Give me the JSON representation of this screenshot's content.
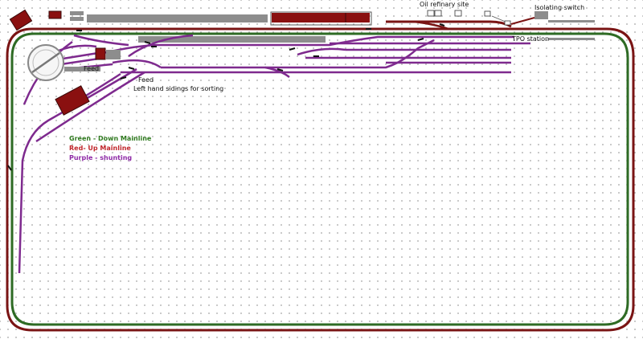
{
  "labels": {
    "oil_refinery": "Oil refinary site",
    "isolating_switch": "Isolating switch",
    "tpo_station": "TPO station",
    "feed_top": "Feed",
    "feed_left": "Feed",
    "left_sidings": "Left hand sidings for sorting"
  },
  "legend": {
    "green": "Green -  Down Mainline",
    "red": "Red-  Up Mainline",
    "purple": "Purple - shunting"
  },
  "colors": {
    "down_mainline": "#2e6b24",
    "up_mainline": "#7a1414",
    "shunting": "#7e2a8e",
    "building": "#8a1010",
    "platform": "#8d8d8d",
    "legend_green": "#2f7a1f",
    "legend_red": "#c0262b",
    "legend_purple": "#8e2aa6"
  },
  "icons": {
    "turntable": "turntable-icon",
    "points_lever": "point-lever-icon"
  }
}
